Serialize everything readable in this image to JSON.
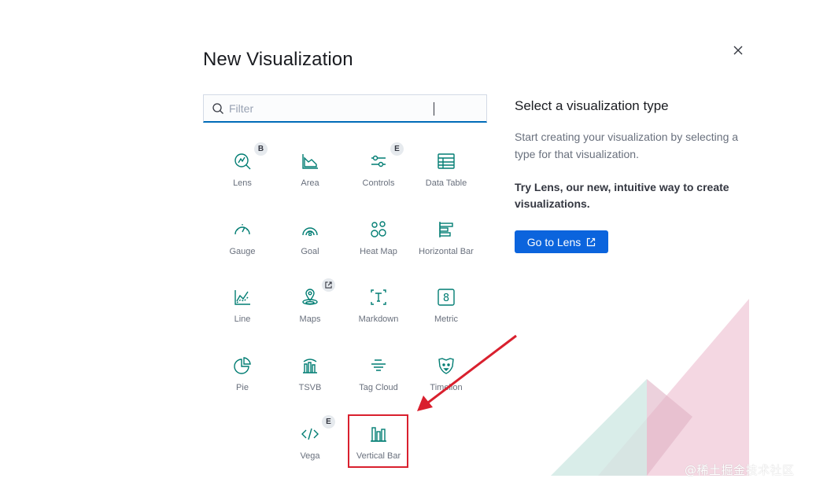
{
  "modal": {
    "title": "New Visualization",
    "close_icon": "close-icon"
  },
  "search": {
    "placeholder": "Filter",
    "value": "",
    "icon": "search-icon"
  },
  "visualizations": [
    {
      "label": "Lens",
      "icon": "lens-icon",
      "badge": "B"
    },
    {
      "label": "Area",
      "icon": "area-chart-icon"
    },
    {
      "label": "Controls",
      "icon": "controls-icon",
      "badge": "E"
    },
    {
      "label": "Data Table",
      "icon": "table-icon"
    },
    {
      "label": "Gauge",
      "icon": "gauge-icon"
    },
    {
      "label": "Goal",
      "icon": "goal-icon"
    },
    {
      "label": "Heat Map",
      "icon": "heatmap-icon"
    },
    {
      "label": "Horizontal Bar",
      "icon": "horizontal-bar-icon"
    },
    {
      "label": "Line",
      "icon": "line-chart-icon"
    },
    {
      "label": "Maps",
      "icon": "maps-icon",
      "badge_icon": "external-link-icon"
    },
    {
      "label": "Markdown",
      "icon": "markdown-icon"
    },
    {
      "label": "Metric",
      "icon": "metric-icon"
    },
    {
      "label": "Pie",
      "icon": "pie-icon"
    },
    {
      "label": "TSVB",
      "icon": "tsvb-icon"
    },
    {
      "label": "Tag Cloud",
      "icon": "tag-cloud-icon"
    },
    {
      "label": "Timelion",
      "icon": "timelion-icon"
    },
    {
      "label": "Vega",
      "icon": "vega-code-icon",
      "badge": "E"
    },
    {
      "label": "Vertical Bar",
      "icon": "vertical-bar-icon"
    }
  ],
  "side_panel": {
    "title": "Select a visualization type",
    "description": "Start creating your visualization by selecting a type for that visualization.",
    "promo": "Try Lens, our new, intuitive way to create visualizations.",
    "button_label": "Go to Lens",
    "button_icon": "external-link-icon"
  },
  "colors": {
    "accent": "#0b64dd",
    "icon": "#017d73",
    "highlight": "#d9202e"
  },
  "watermark": "@稀土掘金技术社区"
}
